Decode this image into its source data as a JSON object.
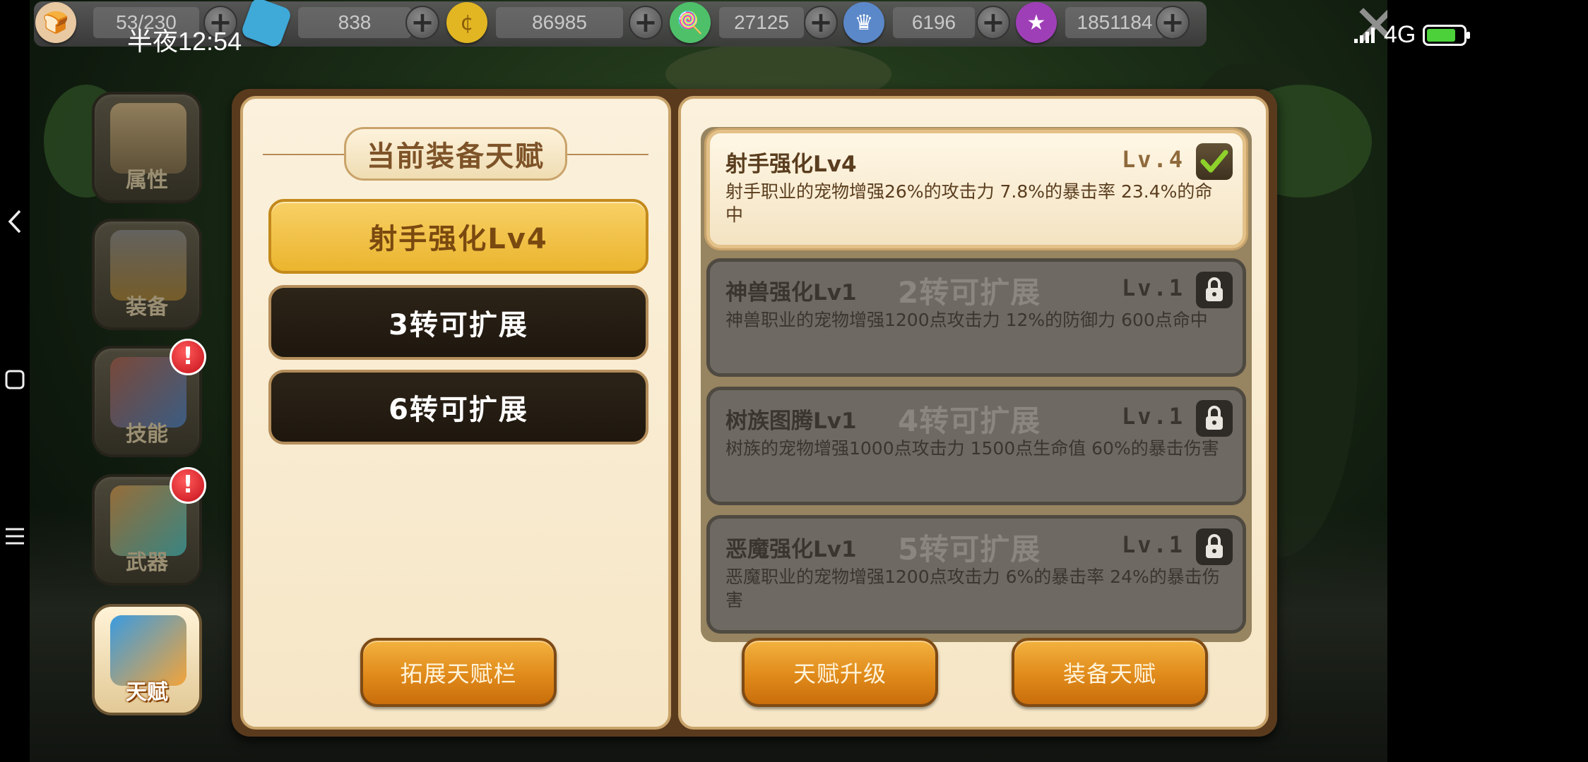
{
  "status_bar": {
    "time": "半夜12:54",
    "network": "4G",
    "battery_level": 0.8
  },
  "resources": [
    {
      "name": "stamina",
      "icon": "bread-icon",
      "value": "53/230",
      "color": "#e9c9a2"
    },
    {
      "name": "diamond",
      "icon": "gem-icon",
      "value": "838",
      "color": "#3fa9d8"
    },
    {
      "name": "gold",
      "icon": "coin-icon",
      "value": "86985",
      "color": "#e2b623"
    },
    {
      "name": "candy",
      "icon": "lollipop-icon",
      "value": "27125",
      "color": "#4fc06a"
    },
    {
      "name": "honor",
      "icon": "badge-icon",
      "value": "6196",
      "color": "#5b88c9"
    },
    {
      "name": "star",
      "icon": "star-icon",
      "value": "1851184",
      "color": "#9f3fb7"
    }
  ],
  "side_menu": [
    {
      "label": "属性",
      "icon": "scroll-icon",
      "alert": false,
      "active": false
    },
    {
      "label": "装备",
      "icon": "helmet-icon",
      "alert": false,
      "active": false
    },
    {
      "label": "技能",
      "icon": "skill-book-icon",
      "alert": true,
      "active": false
    },
    {
      "label": "武器",
      "icon": "bow-quiver-icon",
      "alert": true,
      "active": false
    },
    {
      "label": "天赋",
      "icon": "talent-chart-icon",
      "alert": false,
      "active": true
    }
  ],
  "alert_mark": "!",
  "left_page": {
    "heading": "当前装备天赋",
    "slots": [
      {
        "label": "射手强化Lv4",
        "state": "equipped"
      },
      {
        "label": "3转可扩展",
        "state": "locked"
      },
      {
        "label": "6转可扩展",
        "state": "locked"
      }
    ],
    "expand_button": "拓展天赋栏"
  },
  "right_page": {
    "talents": [
      {
        "title": "射手强化Lv4",
        "unlock": "",
        "level": "Lv.4",
        "desc": "射手职业的宠物增强26%的攻击力 7.8%的暴击率 23.4%的命中",
        "state": "active"
      },
      {
        "title": "神兽强化Lv1",
        "unlock": "2转可扩展",
        "level": "Lv.1",
        "desc": "神兽职业的宠物增强1200点攻击力 12%的防御力 600点命中",
        "state": "locked"
      },
      {
        "title": "树族图腾Lv1",
        "unlock": "4转可扩展",
        "level": "Lv.1",
        "desc": "树族的宠物增强1000点攻击力 1500点生命值 60%的暴击伤害",
        "state": "locked"
      },
      {
        "title": "恶魔强化Lv1",
        "unlock": "5转可扩展",
        "level": "Lv.1",
        "desc": "恶魔职业的宠物增强1200点攻击力 6%的暴击率 24%的暴击伤害",
        "state": "locked"
      }
    ],
    "upgrade_button": "天赋升级",
    "equip_button": "装备天赋"
  }
}
